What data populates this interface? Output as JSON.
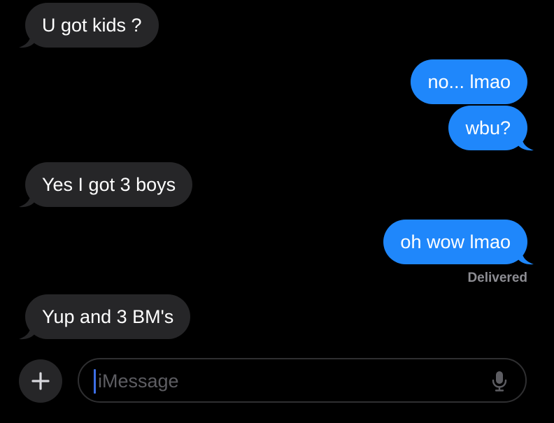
{
  "messages": [
    {
      "direction": "incoming",
      "text": "U got kids ?"
    },
    {
      "direction": "outgoing",
      "text": "no... lmao"
    },
    {
      "direction": "outgoing",
      "text": "wbu?"
    },
    {
      "direction": "incoming",
      "text": "Yes I got 3 boys"
    },
    {
      "direction": "outgoing",
      "text": "oh wow lmao"
    },
    {
      "direction": "incoming",
      "text": "Yup and 3 BM's"
    }
  ],
  "status": "Delivered",
  "composer": {
    "placeholder": "iMessage",
    "add_icon": "plus-icon",
    "dictation_icon": "microphone-icon"
  },
  "colors": {
    "background": "#000000",
    "incoming_bubble": "#262628",
    "outgoing_bubble": "#1f87fb",
    "status_text": "#8d8d93",
    "caret": "#3d6fe6"
  }
}
